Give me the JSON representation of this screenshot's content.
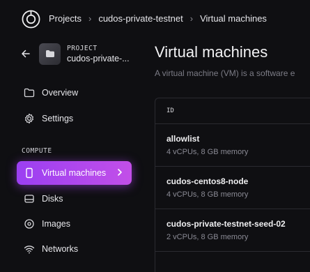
{
  "breadcrumb": [
    "Projects",
    "cudos-private-testnet",
    "Virtual machines"
  ],
  "project": {
    "label": "PROJECT",
    "name": "cudos-private-..."
  },
  "nav": {
    "overview": "Overview",
    "settings": "Settings",
    "section_compute": "COMPUTE",
    "virtual_machines": "Virtual machines",
    "disks": "Disks",
    "images": "Images",
    "networks": "Networks"
  },
  "main": {
    "title": "Virtual machines",
    "description": "A virtual machine (VM) is a software e"
  },
  "table": {
    "header_id": "ID",
    "rows": [
      {
        "name": "allowlist",
        "spec": "4 vCPUs, 8 GB memory"
      },
      {
        "name": "cudos-centos8-node",
        "spec": "4 vCPUs, 8 GB memory"
      },
      {
        "name": "cudos-private-testnet-seed-02",
        "spec": "2 vCPUs, 8 GB memory"
      }
    ]
  },
  "colors": {
    "accent_start": "#9b3ff2",
    "accent_end": "#c24fe8",
    "background": "#0f0f12"
  }
}
